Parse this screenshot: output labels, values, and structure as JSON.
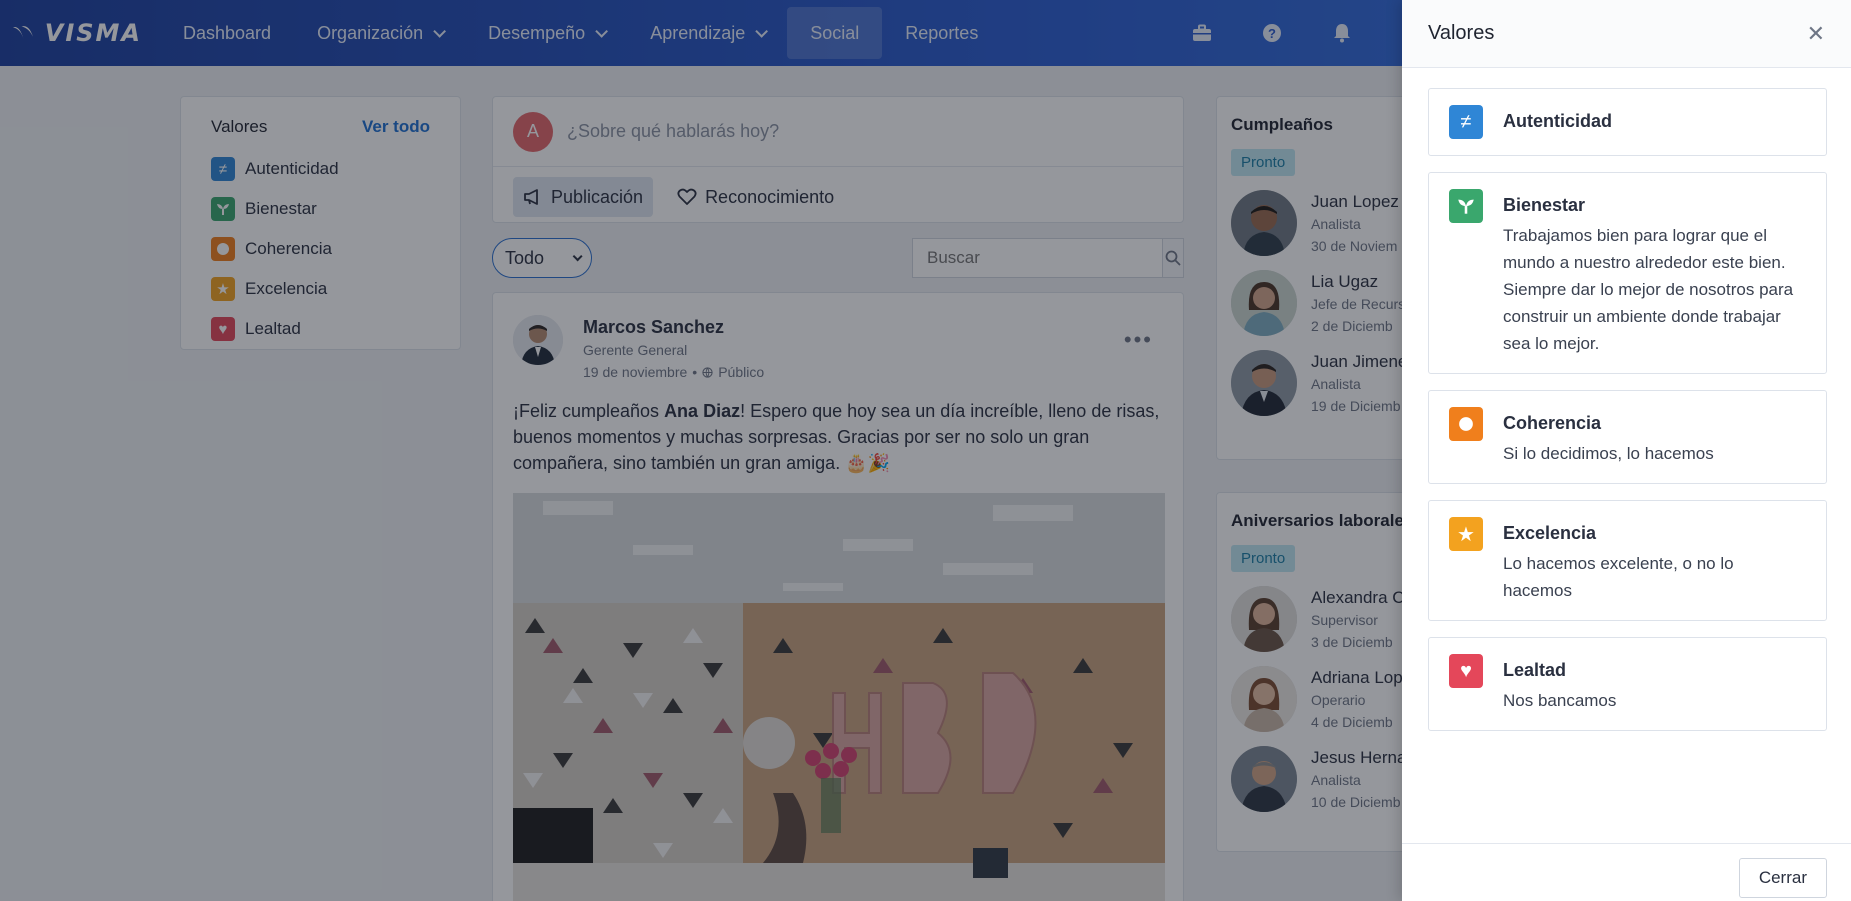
{
  "nav": {
    "logo": "VISMA",
    "items": [
      {
        "label": "Dashboard",
        "dropdown": false,
        "active": false
      },
      {
        "label": "Organización",
        "dropdown": true,
        "active": false
      },
      {
        "label": "Desempeño",
        "dropdown": true,
        "active": false
      },
      {
        "label": "Aprendizaje",
        "dropdown": true,
        "active": false
      },
      {
        "label": "Social",
        "dropdown": false,
        "active": true
      },
      {
        "label": "Reportes",
        "dropdown": false,
        "active": false
      }
    ],
    "icons": [
      "briefcase-icon",
      "help-icon",
      "bell-icon"
    ]
  },
  "values_card": {
    "title": "Valores",
    "link": "Ver todo",
    "items": [
      {
        "label": "Autenticidad",
        "color": "#2f86d6",
        "icon": "≠"
      },
      {
        "label": "Bienestar",
        "color": "#3aa76d",
        "icon": "sprout"
      },
      {
        "label": "Coherencia",
        "color": "#f07f1c",
        "icon": "circle"
      },
      {
        "label": "Excelencia",
        "color": "#f3a21f",
        "icon": "★"
      },
      {
        "label": "Lealtad",
        "color": "#e4475a",
        "icon": "♥"
      }
    ]
  },
  "composer": {
    "avatar_letter": "A",
    "placeholder": "¿Sobre qué hablarás hoy?",
    "post_button": "Publicación",
    "recognition_button": "Reconocimiento"
  },
  "filter": {
    "selected": "Todo"
  },
  "search": {
    "placeholder": "Buscar"
  },
  "post": {
    "author": "Marcos Sanchez",
    "role": "Gerente General",
    "date": "19 de noviembre",
    "visibility": "Público",
    "text_before": "¡Feliz cumpleaños ",
    "text_bold": "Ana Diaz",
    "text_after": "! Espero que hoy sea un día increíble, lleno de risas, buenos momentos y muchas sorpresas. Gracias por ser no solo un gran compañera, sino también un gran amiga. 🎂🎉"
  },
  "birthdays": {
    "title": "Cumpleaños",
    "pill": "Pronto",
    "people": [
      {
        "name": "Juan Lopez",
        "role": "Analista",
        "date": "30 de Noviem"
      },
      {
        "name": "Lia Ugaz",
        "role": "Jefe de Recurs",
        "date": "2 de Diciemb"
      },
      {
        "name": "Juan Jimene",
        "role": "Analista",
        "date": "19 de Diciemb"
      }
    ]
  },
  "anniversaries": {
    "title": "Aniversarios laborales",
    "pill": "Pronto",
    "people": [
      {
        "name": "Alexandra C",
        "role": "Supervisor",
        "date": "3 de Diciemb"
      },
      {
        "name": "Adriana Lop",
        "role": "Operario",
        "date": "4 de Diciemb"
      },
      {
        "name": "Jesus Herna",
        "role": "Analista",
        "date": "10 de Diciemb"
      }
    ]
  },
  "drawer": {
    "title": "Valores",
    "close_label": "Cerrar",
    "values": [
      {
        "name": "Autenticidad",
        "desc": "",
        "color": "#2f86d6"
      },
      {
        "name": "Bienestar",
        "desc": "Trabajamos bien para lograr que el mundo a nuestro alrededor este bien. Siempre dar lo mejor de nosotros para construir un ambiente donde trabajar sea lo mejor.",
        "color": "#3aa76d"
      },
      {
        "name": "Coherencia",
        "desc": "Si lo decidimos, lo hacemos",
        "color": "#f07f1c"
      },
      {
        "name": "Excelencia",
        "desc": "Lo hacemos excelente, o no lo hacemos",
        "color": "#f3a21f"
      },
      {
        "name": "Lealtad",
        "desc": "Nos bancamos",
        "color": "#e4475a"
      }
    ]
  }
}
